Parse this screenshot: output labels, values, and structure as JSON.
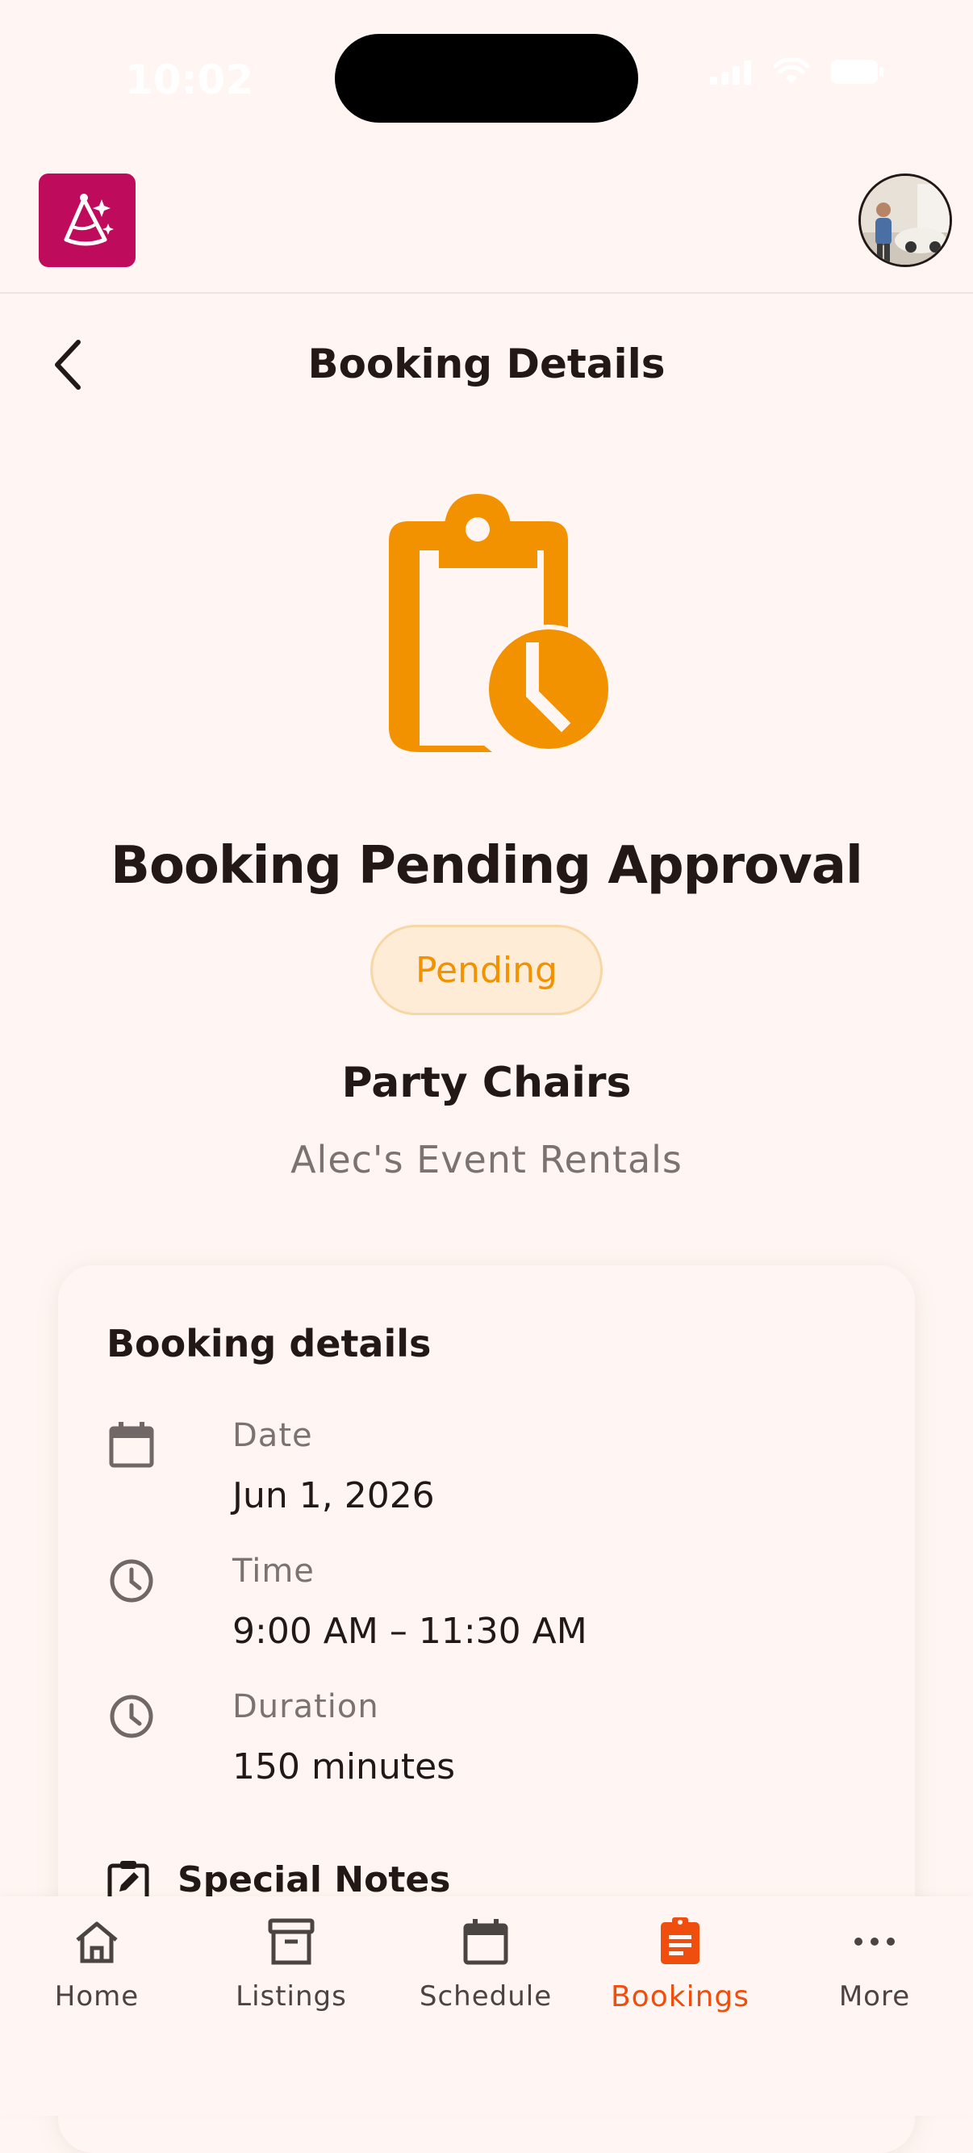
{
  "status_bar": {
    "time": "10:02"
  },
  "header": {
    "logo_icon": "party-hat-icon",
    "avatar_icon": "avatar"
  },
  "page": {
    "title": "Booking Details",
    "back_icon": "chevron-left-icon"
  },
  "status": {
    "icon": "clipboard-clock-icon",
    "title": "Booking Pending Approval",
    "badge": "Pending",
    "accent_color": "#F39200"
  },
  "listing": {
    "name": "Party Chairs",
    "vendor": "Alec's Event Rentals"
  },
  "details_card": {
    "title": "Booking details",
    "rows": [
      {
        "icon": "calendar-icon",
        "label": "Date",
        "value": "Jun 1, 2026"
      },
      {
        "icon": "clock-icon",
        "label": "Time",
        "value": "9:00 AM – 11:30 AM"
      },
      {
        "icon": "clock-icon",
        "label": "Duration",
        "value": "150 minutes"
      }
    ],
    "notes_label": "Special Notes"
  },
  "bottom_nav": {
    "active_color": "#F04E0F",
    "items": [
      {
        "icon": "home-icon",
        "label": "Home",
        "active": false
      },
      {
        "icon": "archive-box-icon",
        "label": "Listings",
        "active": false
      },
      {
        "icon": "calendar-icon",
        "label": "Schedule",
        "active": false
      },
      {
        "icon": "clipboard-list-icon",
        "label": "Bookings",
        "active": true
      },
      {
        "icon": "more-dots-icon",
        "label": "More",
        "active": false
      }
    ]
  }
}
